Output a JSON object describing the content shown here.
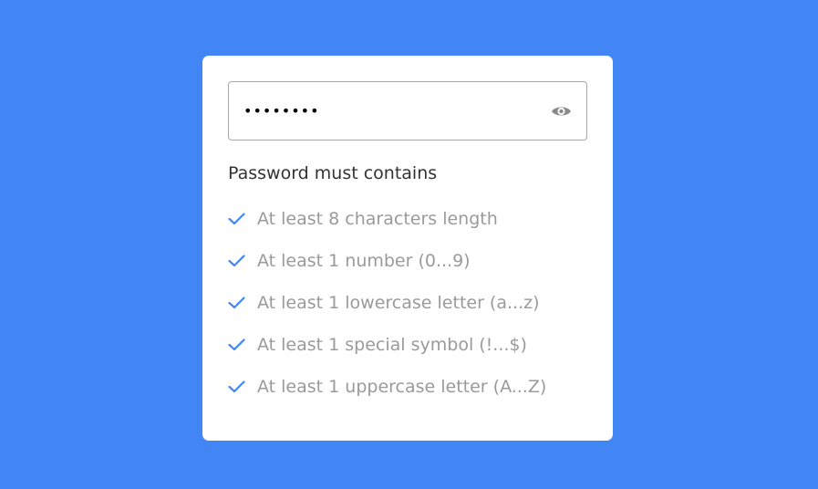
{
  "colors": {
    "background": "#4285f4",
    "card": "#ffffff",
    "check": "#4285f4",
    "requirement_text": "#9a9a9a",
    "heading_text": "#333333"
  },
  "password_field": {
    "value": "••••••••",
    "masked": true,
    "toggle_icon": "eye-icon"
  },
  "requirements": {
    "heading": "Password must contains",
    "items": [
      {
        "label": "At least 8 characters length",
        "met": true,
        "icon": "check-icon"
      },
      {
        "label": "At least 1 number (0...9)",
        "met": true,
        "icon": "check-icon"
      },
      {
        "label": "At least 1 lowercase letter (a...z)",
        "met": true,
        "icon": "check-icon"
      },
      {
        "label": "At least 1 special symbol (!...$)",
        "met": true,
        "icon": "check-icon"
      },
      {
        "label": "At least 1 uppercase letter (A...Z)",
        "met": true,
        "icon": "check-icon"
      }
    ]
  }
}
